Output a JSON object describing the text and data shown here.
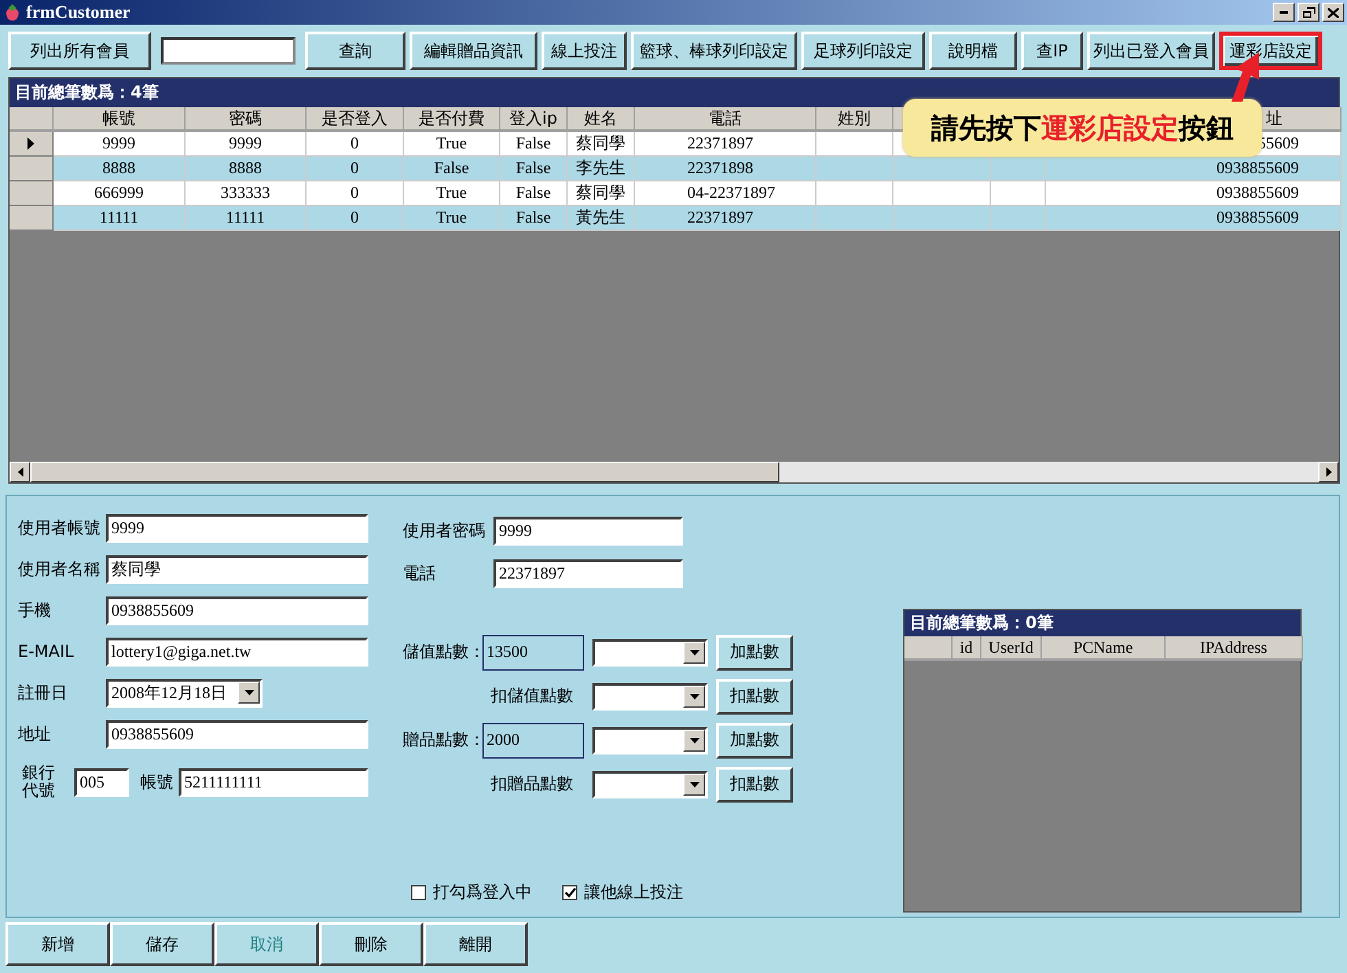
{
  "window": {
    "title": "frmCustomer"
  },
  "toolbar": [
    {
      "kind": "button",
      "label": "列出所有會員",
      "highlighted": false
    },
    {
      "kind": "field"
    },
    {
      "kind": "button",
      "label": "查詢",
      "highlighted": false
    },
    {
      "kind": "button",
      "label": "編輯贈品資訊",
      "highlighted": false
    },
    {
      "kind": "button",
      "label": "線上投注",
      "highlighted": false
    },
    {
      "kind": "button",
      "label": "籃球、棒球列印設定",
      "highlighted": false
    },
    {
      "kind": "button",
      "label": "足球列印設定",
      "highlighted": false
    },
    {
      "kind": "button",
      "label": "說明檔",
      "highlighted": false
    },
    {
      "kind": "button",
      "label": "查IP",
      "highlighted": false
    },
    {
      "kind": "button",
      "label": "列出已登入會員",
      "highlighted": false
    },
    {
      "kind": "button",
      "label": "運彩店設定",
      "highlighted": true
    }
  ],
  "callout": {
    "before": "請先按下",
    "highlight": "運彩店設定",
    "after": "按鈕"
  },
  "members_grid": {
    "caption": "目前總筆數爲：4筆",
    "columns": [
      {
        "label": "帳號"
      },
      {
        "label": "密碼"
      },
      {
        "label": "是否登入"
      },
      {
        "label": "是否付費"
      },
      {
        "label": "登入ip"
      },
      {
        "label": "姓名"
      },
      {
        "label": "電話"
      },
      {
        "label": "姓別"
      },
      {},
      {},
      {
        "label": "址"
      }
    ],
    "rows": [
      {
        "selected": true,
        "cells": [
          "9999",
          "9999",
          "0",
          "True",
          "False",
          "蔡同學",
          "22371897",
          null,
          null,
          null,
          "55609"
        ]
      },
      {
        "selected": false,
        "cells": [
          "8888",
          "8888",
          "0",
          "False",
          "False",
          "李先生",
          "22371898",
          null,
          null,
          null,
          "0938855609"
        ]
      },
      {
        "selected": false,
        "cells": [
          "666999",
          "333333",
          "0",
          "True",
          "False",
          "蔡同學",
          "04-22371897",
          null,
          null,
          null,
          "0938855609"
        ]
      },
      {
        "selected": false,
        "cells": [
          "11111",
          "11111",
          "0",
          "True",
          "False",
          "黃先生",
          "22371897",
          null,
          null,
          null,
          "0938855609"
        ]
      }
    ]
  },
  "form": {
    "left": [
      {
        "kind": "text",
        "label": "使用者帳號",
        "value": "9999"
      },
      {
        "kind": "text",
        "label": "使用者名稱",
        "value": "蔡同學"
      },
      {
        "kind": "text",
        "label": "手機",
        "value": "0938855609"
      },
      {
        "kind": "text",
        "label": "E-MAIL",
        "value": "lottery1@giga.net.tw"
      },
      {
        "kind": "date",
        "label": "註冊日",
        "value": "2008年12月18日"
      },
      {
        "kind": "text",
        "label": "地址",
        "value": "0938855609"
      },
      {
        "kind": "bank",
        "label": "銀行代號",
        "value": "005",
        "account_label": "帳號",
        "account_value": "5211111111"
      }
    ],
    "right": [
      {
        "label": "使用者密碼",
        "value": "9999"
      },
      {
        "label": "電話",
        "value": "22371897"
      }
    ],
    "points": [
      {
        "kind": "balance",
        "label": "儲值點數：",
        "value": "13500",
        "button": "加點數"
      },
      {
        "kind": "deduct",
        "label": "扣儲值點數",
        "button": "扣點數"
      },
      {
        "kind": "balance",
        "label": "贈品點數：",
        "value": "2000",
        "button": "加點數"
      },
      {
        "kind": "deduct",
        "label": "扣贈品點數",
        "button": "扣點數"
      }
    ],
    "checkboxes": [
      {
        "label": "打勾爲登入中",
        "checked": false
      },
      {
        "label": "讓他線上投注",
        "checked": true
      }
    ]
  },
  "logins_grid": {
    "caption": "目前總筆數爲：0筆",
    "columns": [
      "id",
      "UserId",
      "PCName",
      "IPAddress"
    ]
  },
  "bottom_buttons": [
    {
      "label": "新增",
      "disabled": false
    },
    {
      "label": "儲存",
      "disabled": false
    },
    {
      "label": "取消",
      "disabled": true
    },
    {
      "label": "刪除",
      "disabled": false
    },
    {
      "label": "離開",
      "disabled": false
    }
  ]
}
